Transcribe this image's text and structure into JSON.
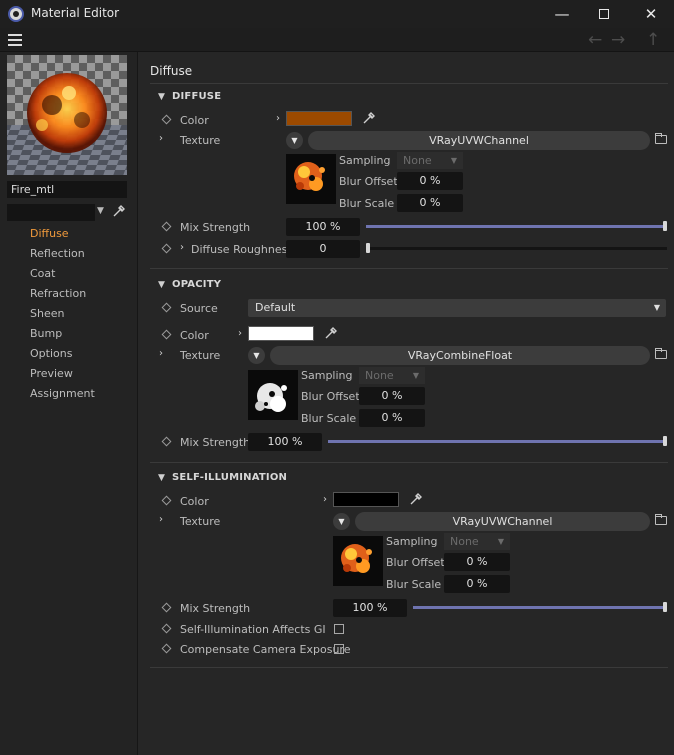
{
  "window": {
    "title": "Material Editor",
    "controls": [
      "minimize-icon",
      "maximize-icon",
      "close-icon"
    ]
  },
  "toolbar": {
    "icons": [
      "menu-icon",
      "back-arrow-icon",
      "forward-arrow-icon",
      "up-arrow-icon"
    ]
  },
  "material": {
    "name": "Fire_mtl"
  },
  "nav": {
    "items": [
      "Diffuse",
      "Reflection",
      "Coat",
      "Refraction",
      "Sheen",
      "Bump",
      "Options",
      "Preview",
      "Assignment"
    ],
    "active": "Diffuse"
  },
  "panel": {
    "title": "Diffuse"
  },
  "diffuse": {
    "heading": "DIFFUSE",
    "color_label": "Color",
    "color_value": "#9c4a00",
    "texture_label": "Texture",
    "texture_name": "VRayUVWChannel",
    "sampling_label": "Sampling",
    "sampling_value": "None",
    "blur_offset_label": "Blur Offset",
    "blur_offset_value": "0 %",
    "blur_scale_label": "Blur Scale",
    "blur_scale_value": "0 %",
    "mix_label": "Mix Strength",
    "mix_value": "100 %",
    "mix_level": 1.0,
    "roughness_label": "Diffuse Roughness",
    "roughness_value": "0",
    "roughness_level": 0.0
  },
  "opacity": {
    "heading": "OPACITY",
    "source_label": "Source",
    "source_value": "Default",
    "color_label": "Color",
    "color_value": "#ffffff",
    "texture_label": "Texture",
    "texture_name": "VRayCombineFloat",
    "sampling_label": "Sampling",
    "sampling_value": "None",
    "blur_offset_label": "Blur Offset",
    "blur_offset_value": "0 %",
    "blur_scale_label": "Blur Scale",
    "blur_scale_value": "0 %",
    "mix_label": "Mix Strength",
    "mix_value": "100 %",
    "mix_level": 1.0
  },
  "self_illumination": {
    "heading": "SELF-ILLUMINATION",
    "color_label": "Color",
    "color_value": "#000000",
    "texture_label": "Texture",
    "texture_name": "VRayUVWChannel",
    "sampling_label": "Sampling",
    "sampling_value": "None",
    "blur_offset_label": "Blur Offset",
    "blur_offset_value": "0 %",
    "blur_scale_label": "Blur Scale",
    "blur_scale_value": "0 %",
    "mix_label": "Mix Strength",
    "mix_value": "100 %",
    "mix_level": 1.0,
    "affects_gi_label": "Self-Illumination Affects GI",
    "affects_gi_checked": false,
    "compensate_label": "Compensate Camera Exposure",
    "compensate_checked": false
  },
  "colors": {
    "accent": "#f09a3c",
    "slider": "#6f74b0"
  }
}
